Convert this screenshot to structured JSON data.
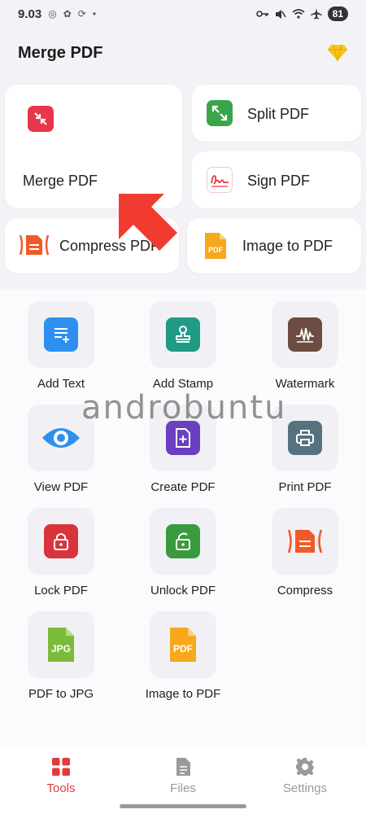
{
  "status_bar": {
    "time": "9.03",
    "dot": "•",
    "battery": "81"
  },
  "app_bar": {
    "title": "Merge PDF",
    "premium_icon": "diamond-icon",
    "premium_color": "#f7c51e"
  },
  "feature_cards": {
    "merge": {
      "label": "Merge PDF",
      "icon": "merge-icon",
      "color": "#e8364a"
    },
    "split": {
      "label": "Split PDF",
      "icon": "split-icon",
      "color": "#3aa54a"
    },
    "sign": {
      "label": "Sign PDF",
      "icon": "signature-icon",
      "color": "#e8364a"
    },
    "compress": {
      "label": "Compress PDF",
      "icon": "compress-icon",
      "color": "#f05a28"
    },
    "image_to_pdf": {
      "label": "Image to PDF",
      "icon": "pdf-file-icon",
      "color": "#f7a81b",
      "badge": "PDF"
    }
  },
  "tools": [
    {
      "label": "Add Text",
      "icon": "add-text-icon",
      "color": "#2f8ff0"
    },
    {
      "label": "Add Stamp",
      "icon": "stamp-icon",
      "color": "#1f9a84"
    },
    {
      "label": "Watermark",
      "icon": "watermark-icon",
      "color": "#6d4c41"
    },
    {
      "label": "View PDF",
      "icon": "eye-icon",
      "color": "#2f8ff0"
    },
    {
      "label": "Create PDF",
      "icon": "create-pdf-icon",
      "color": "#6a3fc2"
    },
    {
      "label": "Print PDF",
      "icon": "printer-icon",
      "color": "#55727f"
    },
    {
      "label": "Lock PDF",
      "icon": "lock-icon",
      "color": "#d9343c"
    },
    {
      "label": "Unlock PDF",
      "icon": "unlock-icon",
      "color": "#3a9a3e"
    },
    {
      "label": "Compress",
      "icon": "compress-icon",
      "color": "#f05a28"
    },
    {
      "label": "PDF to JPG",
      "icon": "jpg-file-icon",
      "color": "#7cba3c",
      "badge": "JPG"
    },
    {
      "label": "Image to PDF",
      "icon": "pdf-file-icon",
      "color": "#f7a81b",
      "badge": "PDF"
    }
  ],
  "watermark_text": "androbuntu",
  "bottom_nav": [
    {
      "label": "Tools",
      "icon": "grid-icon",
      "active": true
    },
    {
      "label": "Files",
      "icon": "file-icon",
      "active": false
    },
    {
      "label": "Settings",
      "icon": "gear-icon",
      "active": false
    }
  ],
  "colors": {
    "accent": "#e23b3b",
    "background": "#f3f3f7",
    "card": "#ffffff"
  }
}
